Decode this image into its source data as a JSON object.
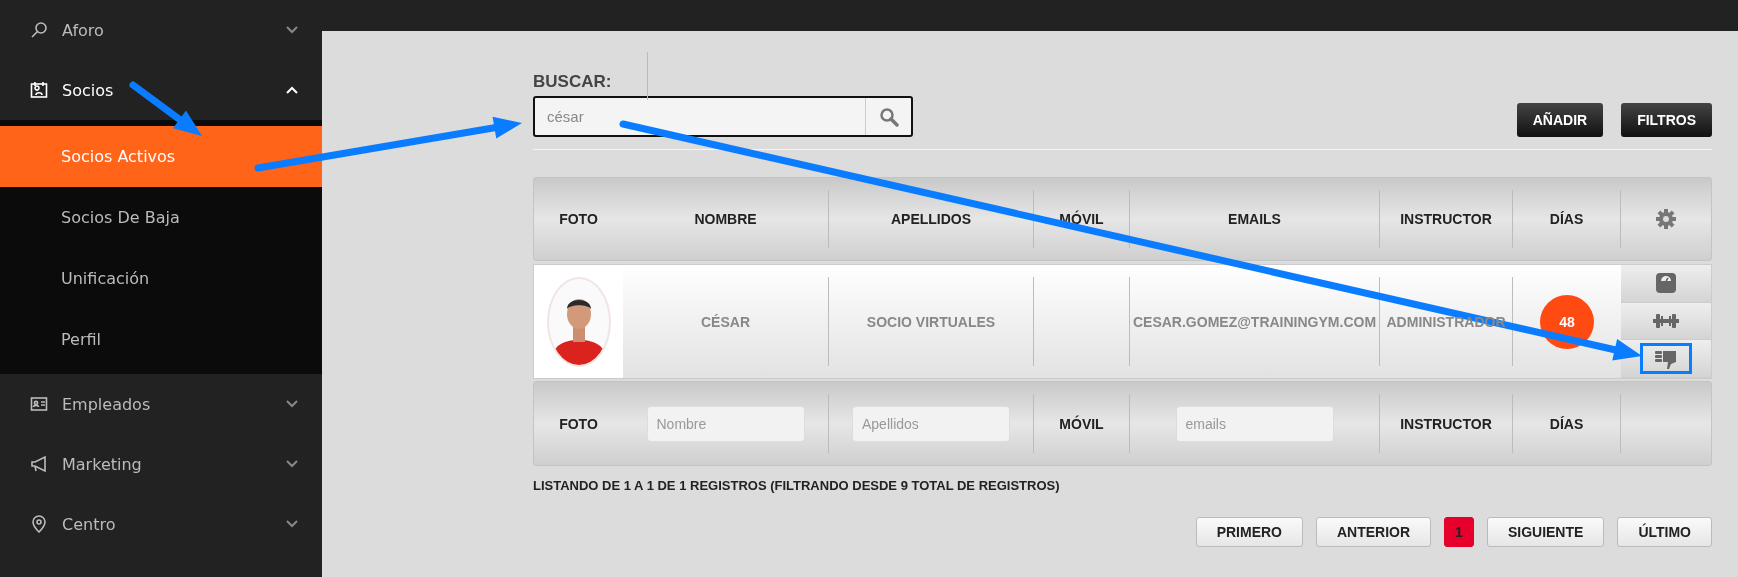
{
  "sidebar": {
    "items": [
      {
        "label": "Aforo",
        "expanded": false
      },
      {
        "label": "Socios",
        "expanded": true,
        "children": [
          {
            "label": "Socios Activos",
            "selected": true
          },
          {
            "label": "Socios De Baja",
            "selected": false
          },
          {
            "label": "Unificación",
            "selected": false
          },
          {
            "label": "Perfil",
            "selected": false
          }
        ]
      },
      {
        "label": "Empleados",
        "expanded": false
      },
      {
        "label": "Marketing",
        "expanded": false
      },
      {
        "label": "Centro",
        "expanded": false
      }
    ]
  },
  "search": {
    "label": "BUSCAR:",
    "value": "césar"
  },
  "buttons": [
    "AÑADIR",
    "FILTROS"
  ],
  "table": {
    "columns": [
      "FOTO",
      "NOMBRE",
      "APELLIDOS",
      "MÓVIL",
      "EMAILS",
      "INSTRUCTOR",
      "DÍAS"
    ],
    "rows": [
      {
        "nombre": "CÉSAR",
        "apellidos": "SOCIO VIRTUALES",
        "email": "CESAR.GOMEZ@TRAININGYM.COM",
        "instructor": "ADMINISTRADOR",
        "dias": "48"
      }
    ],
    "filters": [
      {
        "kind": "label",
        "text": "FOTO"
      },
      {
        "kind": "field",
        "placeholder": "Nombre"
      },
      {
        "kind": "field",
        "placeholder": "Apellidos"
      },
      {
        "kind": "label",
        "text": "MÓVIL"
      },
      {
        "kind": "field",
        "placeholder": "emails"
      },
      {
        "kind": "label",
        "text": "INSTRUCTOR"
      },
      {
        "kind": "label",
        "text": "DÍAS"
      }
    ]
  },
  "info": "LISTANDO DE 1 A 1 DE 1 REGISTROS (FILTRANDO DESDE 9 TOTAL DE REGISTROS)",
  "pagination": [
    {
      "label": "PRIMERO",
      "selected": false
    },
    {
      "label": "ANTERIOR",
      "selected": false
    },
    {
      "label": "1",
      "selected": true
    },
    {
      "label": "SIGUIENTE",
      "selected": false
    },
    {
      "label": "ÚLTIMO",
      "selected": false
    }
  ]
}
